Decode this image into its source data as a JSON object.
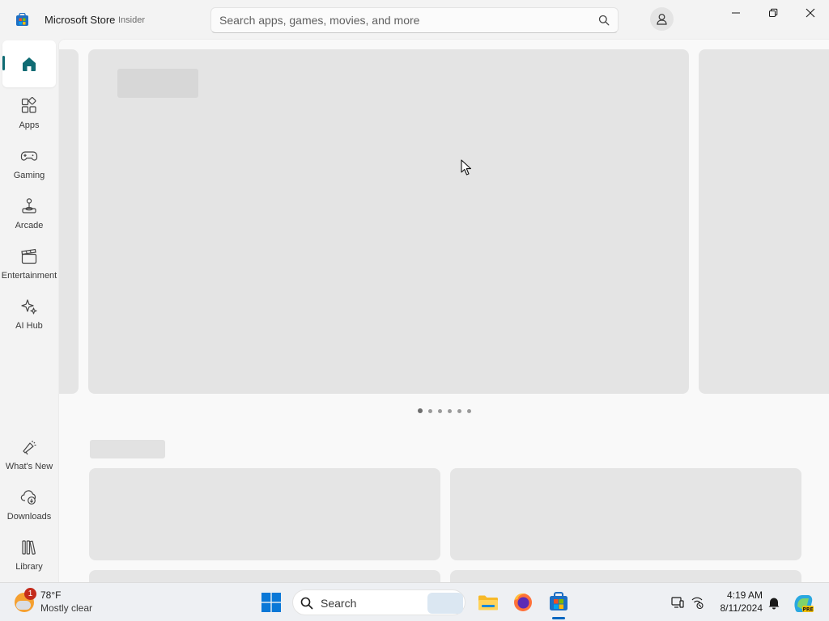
{
  "titlebar": {
    "app_title": "Microsoft Store",
    "app_badge": "Insider",
    "search_placeholder": "Search apps, games, movies, and more"
  },
  "nav": {
    "items": [
      {
        "label": "",
        "icon": "home-icon",
        "active": true
      },
      {
        "label": "Apps",
        "icon": "apps-icon"
      },
      {
        "label": "Gaming",
        "icon": "gamepad-icon"
      },
      {
        "label": "Arcade",
        "icon": "joystick-icon"
      },
      {
        "label": "Entertainment",
        "icon": "clapperboard-icon"
      },
      {
        "label": "AI Hub",
        "icon": "sparkle-icon"
      }
    ],
    "bottom_items": [
      {
        "label": "What's New",
        "icon": "megaphone-icon"
      },
      {
        "label": "Downloads",
        "icon": "cloud-download-icon"
      },
      {
        "label": "Library",
        "icon": "library-icon"
      }
    ]
  },
  "content": {
    "pager_count": 6,
    "pager_active": 0
  },
  "taskbar": {
    "weather": {
      "temp": "78°F",
      "condition": "Mostly clear",
      "badge": "1"
    },
    "search_label": "Search",
    "clock": {
      "time": "4:19 AM",
      "date": "8/11/2024"
    }
  },
  "colors": {
    "accent": "#0f6b73",
    "skeleton": "#e4e4e4",
    "taskbar": "#eef0f3"
  }
}
